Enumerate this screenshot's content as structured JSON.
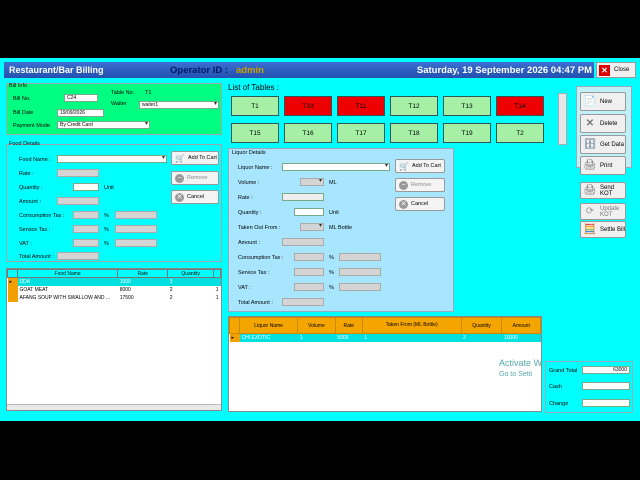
{
  "window": {
    "title": "Restaurant/Bar Billing",
    "operator_label": "Operator ID :",
    "operator_value": "admin",
    "datetime": "Saturday, 19 September 2026 04:47 PM",
    "close_label": "Close"
  },
  "bill_info": {
    "group": "Bill Info",
    "bill_no_label": "Bill No.",
    "bill_no": "C24",
    "table_no_label": "Table No.",
    "table_no": "T1",
    "bill_date_label": "Bill Date",
    "bill_date": "19/09/2026",
    "waiter_label": "Waiter",
    "waiter": "waiter1",
    "payment_label": "Payment Mode",
    "payment": "By Credit Card"
  },
  "food": {
    "group": "Food Details",
    "name_label": "Food Name :",
    "rate_label": "Rate :",
    "qty_label": "Quantity :",
    "unit_label": "Unit",
    "amount_label": "Amount :",
    "consumption_label": "Consumption Tax :",
    "service_label": "Service Tax :",
    "vat_label": "VAT :",
    "total_label": "Total Amount :",
    "pct": "%",
    "add_label": "Add To Cart",
    "remove_label": "Remove",
    "cancel_label": "Cancel"
  },
  "food_grid": {
    "headers": [
      "Food Name",
      "Rate",
      "Quantity"
    ],
    "rows": [
      [
        "DDA",
        "1000",
        "3"
      ],
      [
        "GOAT MEAT",
        "8000",
        "2"
      ],
      [
        "AFANG SOUP WITH SWALLOW AND ...",
        "17500",
        "2"
      ]
    ],
    "extra": [
      "",
      "1",
      "1"
    ]
  },
  "tables": {
    "title": "List of Tables :",
    "items": [
      {
        "label": "T1",
        "color": "#a6f0a6"
      },
      {
        "label": "T10",
        "color": "#ee0000"
      },
      {
        "label": "T11",
        "color": "#ee0000"
      },
      {
        "label": "T12",
        "color": "#a6f0a6"
      },
      {
        "label": "T13",
        "color": "#a6f0a6"
      },
      {
        "label": "T14",
        "color": "#ee0000"
      },
      {
        "label": "T15",
        "color": "#a6f0a6"
      },
      {
        "label": "T16",
        "color": "#a6f0a6"
      },
      {
        "label": "T17",
        "color": "#a6f0a6"
      },
      {
        "label": "T18",
        "color": "#a6f0a6"
      },
      {
        "label": "T19",
        "color": "#a6f0a6"
      },
      {
        "label": "T2",
        "color": "#a6f0a6"
      }
    ]
  },
  "liquor": {
    "group": "Liquor Details",
    "name_label": "Liquor Name :",
    "volume_label": "Volume :",
    "ml": "ML",
    "rate_label": "Rate :",
    "qty_label": "Quantity :",
    "unit_label": "Unit",
    "taken_label": "Taken Out From :",
    "ml_bottle": "ML Bottle",
    "amount_label": "Amount :",
    "consumption_label": "Consumption Tax :",
    "service_label": "Service Tax :",
    "vat_label": "VAT :",
    "total_label": "Total Amount :",
    "pct": "%",
    "add_label": "Add To Cart",
    "remove_label": "Remove",
    "cancel_label": "Cancel"
  },
  "liquor_grid": {
    "headers": [
      "Liquor Name",
      "Volume",
      "Rate",
      "Taken From (ML Bottle)",
      "Quantity",
      "Amount"
    ],
    "rows": [
      [
        "CHI EXOTIC",
        "1",
        "5000",
        "1",
        "2",
        "10000"
      ]
    ]
  },
  "actions": {
    "new": "New",
    "delete": "Delete",
    "get_data": "Get Data",
    "print": "Print",
    "send_kot": "Send KOT",
    "update_kot": "Update KOT",
    "settle_bill": "Settle Bill"
  },
  "totals": {
    "grand_label": "Grand Total",
    "grand": "63000",
    "cash_label": "Cash",
    "change_label": "Change"
  },
  "watermark": {
    "line1": "Activate W",
    "line2": "Go to Setti"
  }
}
